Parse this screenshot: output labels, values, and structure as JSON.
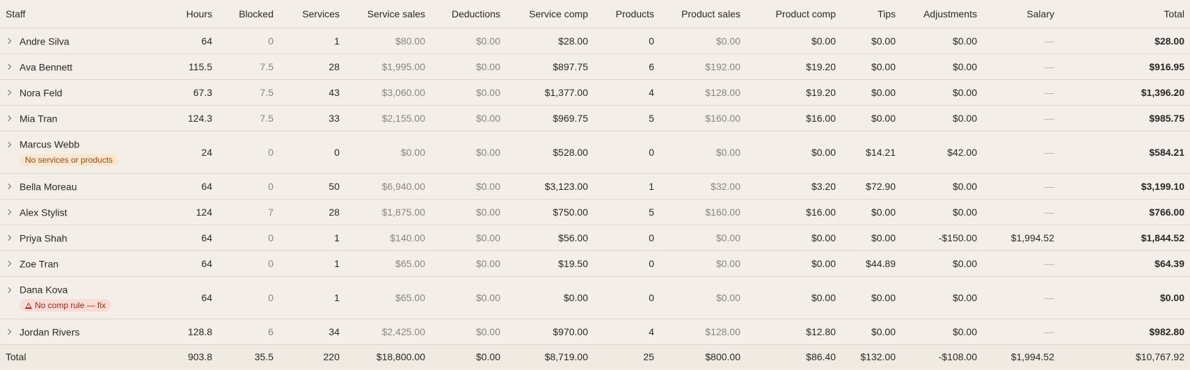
{
  "columns": {
    "staff": "Staff",
    "hours": "Hours",
    "blocked": "Blocked",
    "services": "Services",
    "service_sales": "Service sales",
    "deductions": "Deductions",
    "service_comp": "Service comp",
    "products": "Products",
    "product_sales": "Product sales",
    "product_comp": "Product comp",
    "tips": "Tips",
    "adjustments": "Adjustments",
    "salary": "Salary",
    "total": "Total"
  },
  "rows": [
    {
      "name": "Andre Silva",
      "hours": "64",
      "blocked": "0",
      "services": "1",
      "service_sales": "$80.00",
      "deductions": "$0.00",
      "service_comp": "$28.00",
      "products": "0",
      "product_sales": "$0.00",
      "product_comp": "$0.00",
      "tips": "$0.00",
      "adjustments": "$0.00",
      "salary": "—",
      "total": "$28.00"
    },
    {
      "name": "Ava Bennett",
      "hours": "115.5",
      "blocked": "7.5",
      "services": "28",
      "service_sales": "$1,995.00",
      "deductions": "$0.00",
      "service_comp": "$897.75",
      "products": "6",
      "product_sales": "$192.00",
      "product_comp": "$19.20",
      "tips": "$0.00",
      "adjustments": "$0.00",
      "salary": "—",
      "total": "$916.95"
    },
    {
      "name": "Nora Feld",
      "hours": "67.3",
      "blocked": "7.5",
      "services": "43",
      "service_sales": "$3,060.00",
      "deductions": "$0.00",
      "service_comp": "$1,377.00",
      "products": "4",
      "product_sales": "$128.00",
      "product_comp": "$19.20",
      "tips": "$0.00",
      "adjustments": "$0.00",
      "salary": "—",
      "total": "$1,396.20"
    },
    {
      "name": "Mia Tran",
      "hours": "124.3",
      "blocked": "7.5",
      "services": "33",
      "service_sales": "$2,155.00",
      "deductions": "$0.00",
      "service_comp": "$969.75",
      "products": "5",
      "product_sales": "$160.00",
      "product_comp": "$16.00",
      "tips": "$0.00",
      "adjustments": "$0.00",
      "salary": "—",
      "total": "$985.75"
    },
    {
      "name": "Marcus Webb",
      "badge": "No services or products",
      "hours": "24",
      "blocked": "0",
      "services": "0",
      "service_sales": "$0.00",
      "deductions": "$0.00",
      "service_comp": "$528.00",
      "products": "0",
      "product_sales": "$0.00",
      "product_comp": "$0.00",
      "tips": "$14.21",
      "adjustments": "$42.00",
      "salary": "—",
      "total": "$584.21"
    },
    {
      "name": "Bella Moreau",
      "hours": "64",
      "blocked": "0",
      "services": "50",
      "service_sales": "$6,940.00",
      "deductions": "$0.00",
      "service_comp": "$3,123.00",
      "products": "1",
      "product_sales": "$32.00",
      "product_comp": "$3.20",
      "tips": "$72.90",
      "adjustments": "$0.00",
      "salary": "—",
      "total": "$3,199.10"
    },
    {
      "name": "Alex Stylist",
      "hours": "124",
      "blocked": "7",
      "services": "28",
      "service_sales": "$1,875.00",
      "deductions": "$0.00",
      "service_comp": "$750.00",
      "products": "5",
      "product_sales": "$160.00",
      "product_comp": "$16.00",
      "tips": "$0.00",
      "adjustments": "$0.00",
      "salary": "—",
      "total": "$766.00"
    },
    {
      "name": "Priya Shah",
      "hours": "64",
      "blocked": "0",
      "services": "1",
      "service_sales": "$140.00",
      "deductions": "$0.00",
      "service_comp": "$56.00",
      "products": "0",
      "product_sales": "$0.00",
      "product_comp": "$0.00",
      "tips": "$0.00",
      "adjustments": "-$150.00",
      "salary": "$1,994.52",
      "total": "$1,844.52"
    },
    {
      "name": "Zoe Tran",
      "hours": "64",
      "blocked": "0",
      "services": "1",
      "service_sales": "$65.00",
      "deductions": "$0.00",
      "service_comp": "$19.50",
      "products": "0",
      "product_sales": "$0.00",
      "product_comp": "$0.00",
      "tips": "$44.89",
      "adjustments": "$0.00",
      "salary": "—",
      "total": "$64.39"
    },
    {
      "name": "Dana Kova",
      "warning": "No comp rule — fix",
      "hours": "64",
      "blocked": "0",
      "services": "1",
      "service_sales": "$65.00",
      "deductions": "$0.00",
      "service_comp": "$0.00",
      "products": "0",
      "product_sales": "$0.00",
      "product_comp": "$0.00",
      "tips": "$0.00",
      "adjustments": "$0.00",
      "salary": "—",
      "total": "$0.00"
    },
    {
      "name": "Jordan Rivers",
      "hours": "128.8",
      "blocked": "6",
      "services": "34",
      "service_sales": "$2,425.00",
      "deductions": "$0.00",
      "service_comp": "$970.00",
      "products": "4",
      "product_sales": "$128.00",
      "product_comp": "$12.80",
      "tips": "$0.00",
      "adjustments": "$0.00",
      "salary": "—",
      "total": "$982.80"
    }
  ],
  "totals": {
    "name": "Total",
    "hours": "903.8",
    "blocked": "35.5",
    "services": "220",
    "service_sales": "$18,800.00",
    "deductions": "$0.00",
    "service_comp": "$8,719.00",
    "products": "25",
    "product_sales": "$800.00",
    "product_comp": "$86.40",
    "tips": "$132.00",
    "adjustments": "-$108.00",
    "salary": "$1,994.52",
    "total": "$10,767.92"
  }
}
